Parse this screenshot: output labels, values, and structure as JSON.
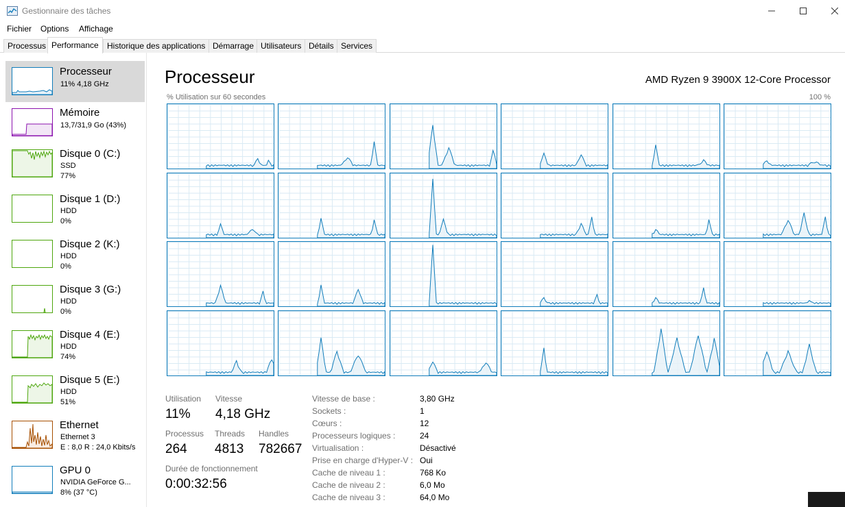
{
  "window": {
    "title": "Gestionnaire des tâches",
    "icon": "task-manager-icon"
  },
  "menu": [
    "Fichier",
    "Options",
    "Affichage"
  ],
  "tabs": [
    {
      "label": "Processus",
      "active": false
    },
    {
      "label": "Performance",
      "active": true
    },
    {
      "label": "Historique des applications",
      "active": false
    },
    {
      "label": "Démarrage",
      "active": false
    },
    {
      "label": "Utilisateurs",
      "active": false
    },
    {
      "label": "Détails",
      "active": false
    },
    {
      "label": "Services",
      "active": false
    }
  ],
  "sidebar": {
    "items": [
      {
        "name": "Processeur",
        "line1": "11% 4,18 GHz",
        "line2": "",
        "color": "#117dbb",
        "selected": true
      },
      {
        "name": "Mémoire",
        "line1": "13,7/31,9 Go (43%)",
        "line2": "",
        "color": "#8b12ae",
        "selected": false
      },
      {
        "name": "Disque 0 (C:)",
        "line1": "SSD",
        "line2": "77%",
        "color": "#4da60c",
        "selected": false
      },
      {
        "name": "Disque 1 (D:)",
        "line1": "HDD",
        "line2": "0%",
        "color": "#4da60c",
        "selected": false
      },
      {
        "name": "Disque 2 (K:)",
        "line1": "HDD",
        "line2": "0%",
        "color": "#4da60c",
        "selected": false
      },
      {
        "name": "Disque 3 (G:)",
        "line1": "HDD",
        "line2": "0%",
        "color": "#4da60c",
        "selected": false
      },
      {
        "name": "Disque 4 (E:)",
        "line1": "HDD",
        "line2": "74%",
        "color": "#4da60c",
        "selected": false
      },
      {
        "name": "Disque 5 (E:)",
        "line1": "HDD",
        "line2": "51%",
        "color": "#4da60c",
        "selected": false
      },
      {
        "name": "Ethernet",
        "line1": "Ethernet 3",
        "line2": "E : 8,0  R : 24,0 Kbits/s",
        "color": "#a74f01",
        "selected": false
      },
      {
        "name": "GPU 0",
        "line1": "NVIDIA GeForce G...",
        "line2": "8% (37 °C)",
        "color": "#117dbb",
        "selected": false
      }
    ]
  },
  "main": {
    "title": "Processeur",
    "model": "AMD Ryzen 9 3900X 12-Core Processor",
    "graph_caption": "% Utilisation sur 60 secondes",
    "graph_max": "100 %",
    "graph_color": "#117dbb",
    "stats": {
      "utilisation_label": "Utilisation",
      "utilisation_value": "11%",
      "vitesse_label": "Vitesse",
      "vitesse_value": "4,18 GHz",
      "processus_label": "Processus",
      "processus_value": "264",
      "threads_label": "Threads",
      "threads_value": "4813",
      "handles_label": "Handles",
      "handles_value": "782667",
      "uptime_label": "Durée de fonctionnement",
      "uptime_value": "0:00:32:56"
    },
    "info": [
      {
        "label": "Vitesse de base :",
        "value": "3,80 GHz"
      },
      {
        "label": "Sockets :",
        "value": "1"
      },
      {
        "label": "Cœurs :",
        "value": "12"
      },
      {
        "label": "Processeurs logiques :",
        "value": "24"
      },
      {
        "label": "Virtualisation :",
        "value": "Désactivé"
      },
      {
        "label": "Prise en charge d'Hyper-V :",
        "value": "Oui"
      },
      {
        "label": "Cache de niveau 1 :",
        "value": "768 Ko"
      },
      {
        "label": "Cache de niveau 2 :",
        "value": "6,0 Mo"
      },
      {
        "label": "Cache de niveau 3 :",
        "value": "64,0 Mo"
      }
    ]
  }
}
